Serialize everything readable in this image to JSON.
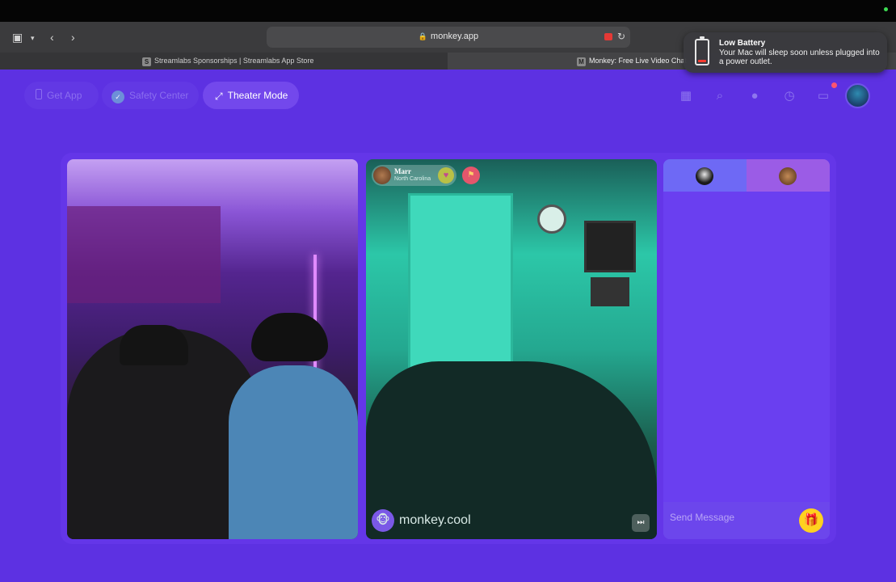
{
  "browser": {
    "url": "monkey.app",
    "tabs": [
      {
        "favicon": "S",
        "title": "Streamlabs Sponsorships | Streamlabs App Store"
      },
      {
        "favicon": "M",
        "title": "Monkey: Free Live Video Chat"
      }
    ],
    "icons": [
      "sidebar-icon",
      "chevron-down-icon",
      "back-icon",
      "forward-icon",
      "lock-icon",
      "record-icon",
      "reload-icon"
    ]
  },
  "notification": {
    "title": "Low Battery",
    "body": "Your Mac will sleep soon unless plugged into a power outlet."
  },
  "header": {
    "get_app": "Get App",
    "safety_center": "Safety Center",
    "theater_mode": "Theater Mode",
    "icons": [
      "gift-box-icon",
      "search-icon",
      "coin-icon",
      "history-icon",
      "chat-icon",
      "profile-avatar"
    ]
  },
  "peer": {
    "name": "Marr",
    "location": "North Carolina"
  },
  "stream": {
    "brand": "monkey.cool"
  },
  "chat": {
    "placeholder": "Send Message"
  },
  "colors": {
    "page_background": "#5d31e2",
    "accent": "#7348ec",
    "gift": "#ffd21f",
    "record": "#e53935"
  }
}
